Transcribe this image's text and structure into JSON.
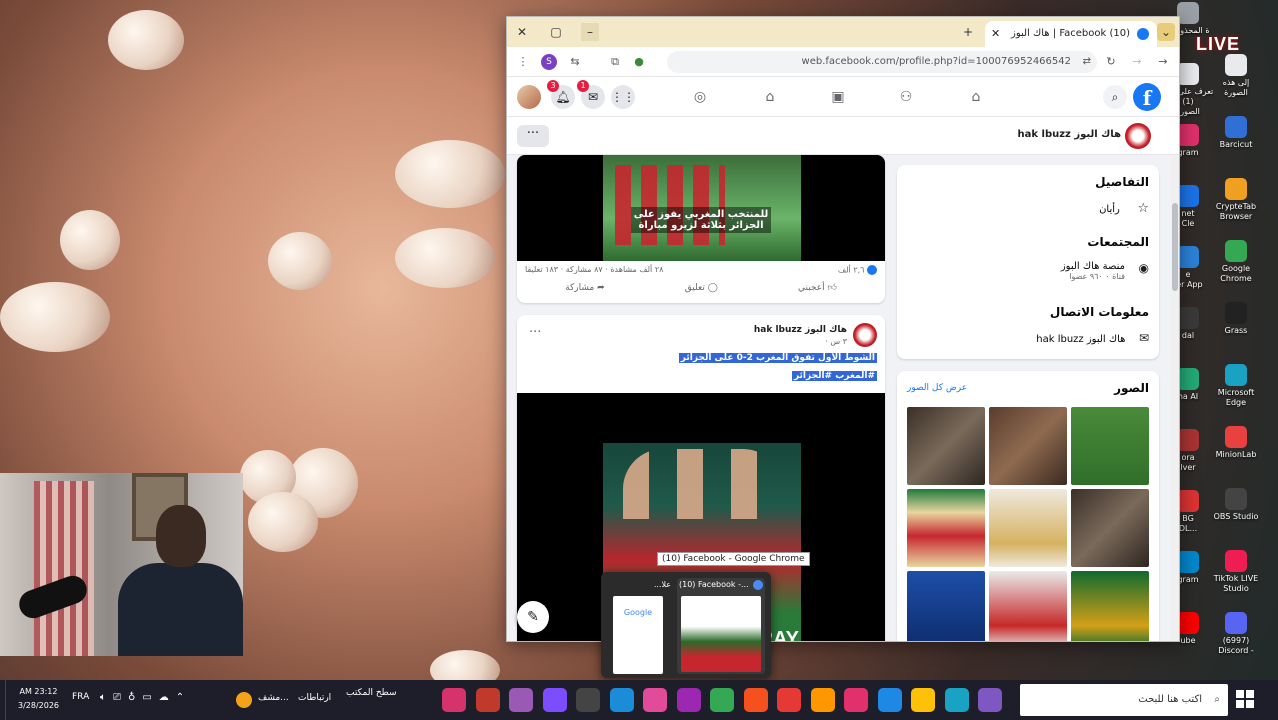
{
  "desktop": {
    "live_logo": "LIVE",
    "right_icons": [
      {
        "label": "إلى هذه\nالصورة",
        "color": "#e8eaed"
      },
      {
        "label": "Barcicut",
        "color": "#2f6fd6"
      },
      {
        "label": "CrypteTab\nBrowser",
        "color": "#f0a020"
      },
      {
        "label": "Google\nChrome",
        "color": "#34a853"
      },
      {
        "label": "Grass",
        "color": "#222222"
      },
      {
        "label": "Microsoft\nEdge",
        "color": "#1aa2c4"
      },
      {
        "label": "MinionLab",
        "color": "#e94040"
      },
      {
        "label": "OBS Studio",
        "color": "#444444"
      },
      {
        "label": "TikTok LIVE\nStudio",
        "color": "#ee1d52"
      },
      {
        "label": "(6997)\nDiscord -",
        "color": "#5865f2"
      }
    ],
    "left_partial_icons": [
      {
        "label": "ة المحذوفات",
        "color": "#9aa0a6"
      },
      {
        "label": "تعرف على هذه (1)\nالصورة",
        "color": "#e8eaed"
      },
      {
        "label": "gram",
        "color": "#e1306c"
      },
      {
        "label": "net\nCle",
        "color": "#1b73e8"
      },
      {
        "label": "e\nfer App",
        "color": "#2b82d9"
      },
      {
        "label": "dal",
        "color": "#3a3a3a"
      },
      {
        "label": "ha AI",
        "color": "#2a7"
      },
      {
        "label": "ora\nlver",
        "color": "#a33"
      },
      {
        "label": "BG\nDL...",
        "color": "#d33"
      },
      {
        "label": "gram",
        "color": "#0088cc"
      },
      {
        "label": "ube",
        "color": "#ff0000"
      }
    ]
  },
  "browser": {
    "tab_title": "هاك البوز | Facebook (10)",
    "url": "web.facebook.com/profile.php?id=100076952466542",
    "ext_badge": "S"
  },
  "facebook": {
    "notifications_count": "3",
    "messenger_count": "1",
    "profile_name": "هاك البوز hak lbuzz",
    "details": {
      "title": "التفاصيل",
      "category": "رأيان"
    },
    "communities": {
      "title": "المجتمعات",
      "name": "منصة هاك البوز",
      "sub": "فناة ٠ ٩٦٠ عضوا"
    },
    "contact": {
      "title": "معلومات الاتصال",
      "value": "هاك البوز hak lbuzz"
    },
    "photos": {
      "title": "الصور",
      "see_all": "عرض كل الصور"
    },
    "post1": {
      "overlay_text": "للمنتخب المغربي يفوز على الجزائر بثلاثة لزيرو مباراة",
      "reactions": "٢,٦ ألف",
      "comments": "١٨٣ تعليقا",
      "shares": "٨٧ مشاركة",
      "views": "٢٨ ألف مشاهدة",
      "like": "أعجبني",
      "comment": "تعليق",
      "share": "مشاركة"
    },
    "post2": {
      "author": "هاك البوز hak lbuzz",
      "time": "٣ س ·",
      "line1": "الشوط الأول تفوق المغرب 2-0 على الجزائر",
      "line2": "#المغرب #الجزائر",
      "banner": "RAY"
    }
  },
  "preview": {
    "tooltip": "(10) Facebook - Google Chrome",
    "thumb1_title": "علا...",
    "thumb2_title": "(10) Facebook -...",
    "thumb1_logo": "Google"
  },
  "taskbar": {
    "search_placeholder": "اكتب هنا للبحث",
    "clock_time": "AM 23:12",
    "clock_date": "3/28/2026",
    "lang": "FRA",
    "widget1": "مشف...",
    "widget2": "ارتباطات",
    "widget3": "سطح المكتب"
  },
  "colors": {
    "facebook_blue": "#1877f2",
    "tabbar": "#f3e9c8",
    "selection": "#3367d6",
    "taskbar": "#1e1e2a"
  }
}
